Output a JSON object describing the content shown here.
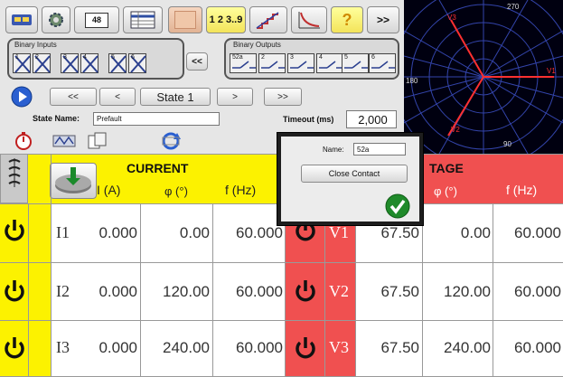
{
  "toolbar": {
    "calendar_label": "48",
    "sequence_label": "1 2 3..9",
    "help_label": "?",
    "more_label": ">>"
  },
  "binary_inputs": {
    "title": "Binary Inputs",
    "cells": [
      "1",
      "2",
      "3",
      "4",
      "5",
      "6"
    ],
    "collapse_label": "<<"
  },
  "binary_outputs": {
    "title": "Binary Outputs",
    "cells": [
      "52a",
      "2",
      "3",
      "4",
      "5",
      "6"
    ]
  },
  "nav": {
    "first": "<<",
    "prev": "<",
    "state": "State 1",
    "next": ">",
    "last": ">>"
  },
  "state_name": {
    "label": "State Name:",
    "value": "Prefault"
  },
  "timeout": {
    "label": "Timeout (ms)",
    "value": "2,000"
  },
  "phasor": {
    "labels": {
      "top": "270",
      "left": "180",
      "bottom": "90",
      "v1": "V1",
      "v2": "V2",
      "v3": "V3"
    },
    "colors": {
      "voltage": "#ff3030",
      "grid": "#3344aa",
      "background": "#000010"
    }
  },
  "popup": {
    "name_label": "Name:",
    "name_value": "52a",
    "button": "Close Contact"
  },
  "current": {
    "title": "CURRENT",
    "col_i": "I (A)",
    "col_phi": "φ (°)",
    "col_f": "f (Hz)",
    "rows": [
      {
        "name": "I1",
        "amp": "0.000",
        "phase": "0.00",
        "freq": "60.000"
      },
      {
        "name": "I2",
        "amp": "0.000",
        "phase": "120.00",
        "freq": "60.000"
      },
      {
        "name": "I3",
        "amp": "0.000",
        "phase": "240.00",
        "freq": "60.000"
      }
    ]
  },
  "voltage": {
    "title": "TAGE",
    "col_phi": "φ (°)",
    "col_f": "f (Hz)",
    "rows": [
      {
        "name": "V1",
        "amp": "67.50",
        "phase": "0.00",
        "freq": "60.000"
      },
      {
        "name": "V2",
        "amp": "67.50",
        "phase": "120.00",
        "freq": "60.000"
      },
      {
        "name": "V3",
        "amp": "67.50",
        "phase": "240.00",
        "freq": "60.000"
      }
    ]
  }
}
